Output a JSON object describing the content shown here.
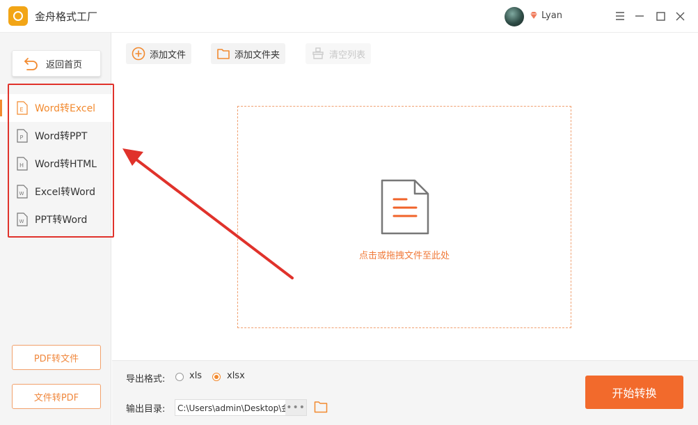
{
  "app": {
    "title": "金舟格式工厂"
  },
  "user": {
    "name": "Lyan"
  },
  "sidebar": {
    "back_label": "返回首页",
    "items": [
      {
        "label": "Word转Excel",
        "icon_letter": "E",
        "active": true
      },
      {
        "label": "Word转PPT",
        "icon_letter": "P",
        "active": false
      },
      {
        "label": "Word转HTML",
        "icon_letter": "H",
        "active": false
      },
      {
        "label": "Excel转Word",
        "icon_letter": "W",
        "active": false
      },
      {
        "label": "PPT转Word",
        "icon_letter": "W",
        "active": false
      }
    ],
    "pdf_to_file": "PDF转文件",
    "file_to_pdf": "文件转PDF"
  },
  "toolbar": {
    "add_file": "添加文件",
    "add_folder": "添加文件夹",
    "clear_list": "清空列表"
  },
  "dropzone": {
    "hint": "点击或拖拽文件至此处"
  },
  "bottom": {
    "format_label": "导出格式:",
    "formats": [
      {
        "label": "xls",
        "checked": false
      },
      {
        "label": "xlsx",
        "checked": true
      }
    ],
    "dir_label": "输出目录:",
    "dir_value": "C:\\Users\\admin\\Desktop\\金",
    "more": "•••",
    "start_label": "开始转换"
  },
  "colors": {
    "accent": "#f28a2f",
    "start_button": "#f26a2c",
    "annotation": "#e0322b"
  }
}
